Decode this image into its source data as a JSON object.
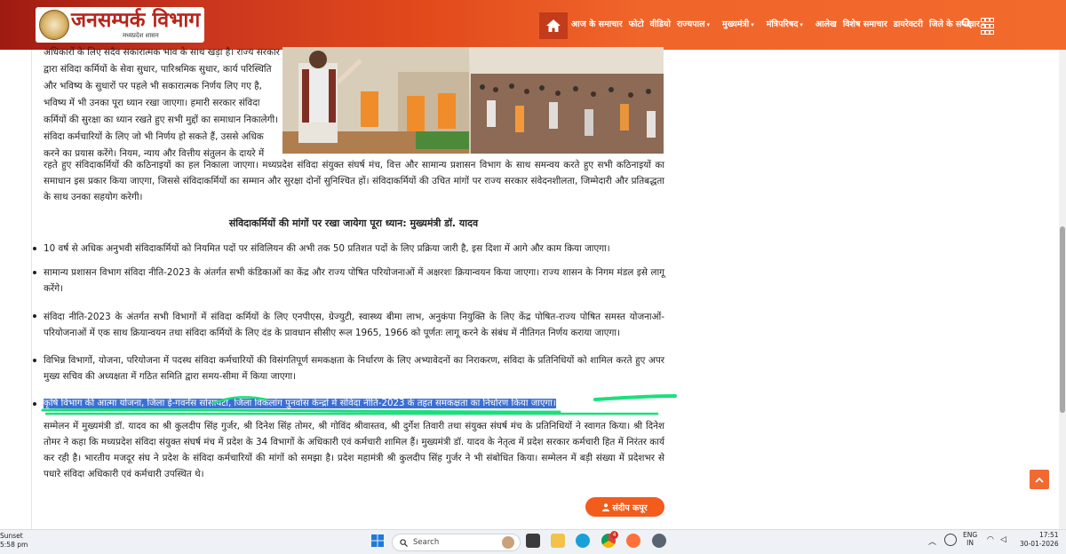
{
  "header": {
    "logo_title": "जनसम्पर्क विभाग",
    "logo_subtitle": "मध्यप्रदेश शासन",
    "nav_items": [
      {
        "label": "आज के समाचार",
        "caret": false
      },
      {
        "label": "फोटो",
        "caret": false
      },
      {
        "label": "वीडियो",
        "caret": false
      },
      {
        "label": "राज्यपाल",
        "caret": true
      },
      {
        "label": "मुख्यमंत्री",
        "caret": true
      },
      {
        "label": "मंत्रिपरिषद",
        "caret": true
      },
      {
        "label": "आलेख",
        "caret": false
      },
      {
        "label": "विशेष समाचार",
        "caret": false
      },
      {
        "label": "डायरेक्टरी",
        "caret": false
      },
      {
        "label": "जिले के समाचार",
        "caret": true
      }
    ],
    "caret_glyph": "▾",
    "brand_color": "#f36a2d"
  },
  "article": {
    "intro_lines": [
      "अधिकारों के लिए सदैव सकारात्मक भाव के साथ खड़ा है। राज्य सरकार",
      "द्वारा संविदा कर्मियों के सेवा सुधार, पारिश्रमिक सुधार, कार्य परिस्थिति",
      "और भविष्य के सुधारों पर पहले भी सकारात्मक निर्णय लिए गए है,",
      "भविष्य में भी उनका पूरा ध्यान रखा जाएगा। हमारी सरकार संविदा",
      "कर्मियों की सुरक्षा का ध्यान रखते हुए सभी मुद्दों का समाधान निकालेगी।",
      "संविदा कर्मचारियों के लिए जो भी निर्णय हो सकते हैं, उससे अधिक",
      "करने का प्रयास करेंगे। नियम, न्याय और वित्तीय संतुलन के दायरे में"
    ],
    "intro_full": "रहते हुए संविदाकर्मियों की कठिनाइयों का हल निकाला जाएगा। मध्यप्रदेश संविदा संयुक्त संघर्ष मंच, वित्त और सामान्य प्रशासन विभाग के साथ समन्वय करते हुए सभी कठिनाइयों का समाधान इस प्रकार किया जाएगा, जिससे संविदाकर्मियों का सम्मान और सुरक्षा दोनों सुनिश्चित हों। संविदाकर्मियों की उचित मांगों पर राज्य सरकार संवेदनशीलता, जिम्मेदारी और प्रतिबद्धता के साथ उनका सहयोग करेगी।",
    "subheading": "संविदाकर्मियों की मांगों पर रखा जायेगा पूरा ध्यान: मुख्यमंत्री डॉ. यादव",
    "bullets": [
      "10 वर्ष से अधिक अनुभवी संविदाकर्मियों को नियमित पदों पर संविलियन की अभी तक 50 प्रतिशत पदों के लिए प्रक्रिया जारी है, इस दिशा में आगे और काम किया जाएगा।",
      "सामान्य प्रशासन विभाग संविदा नीति-2023 के अंतर्गत सभी कंडिकाओं का केंद्र और राज्य पोषित परियोजनाओं में अक्षरशः क्रियान्वयन किया जाएगा। राज्य शासन के निगम मंडल इसे लागू करेंगे।",
      "संविदा नीति-2023 के अंतर्गत सभी विभागों में संविदा कर्मियों के लिए एनपीएस, ग्रेज्युटी, स्वास्थ्य बीमा लाभ, अनुकंपा नियुक्ति के लिए केंद्र पोषित-राज्य पोषित समस्त योजनाओं-परियोजनाओं में एक साथ क्रियान्वयन तथा संविदा कर्मियों के लिए दंड के प्रावधान सीसीए रूल 1965, 1966 को पूर्णतः लागू करने के संबंध में नीतिगत निर्णय कराया जाएगा।",
      "विभिन्न विभागों, योजना, परियोजना में पदस्थ संविदा कर्मचारियों की विसंगतिपूर्ण समकक्षता के निर्धारण के लिए अभ्यावेदनों का निराकरण, संविदा के प्रतिनिधियों को शामिल करते हुए अपर मुख्य सचिव की अध्यक्षता में गठित समिति द्वारा समय-सीमा में किया जाएगा।",
      "कृषि विभाग की आत्मा योजना, जिला ई-गवर्नेंस सोसायटी, जिला विकलांग पुनर्वास केन्द्रों में संविदा नीति-2023 के तहत समकक्षता का निर्धारण किया जाएगा।"
    ],
    "closing": "सम्मेलन में मुख्यमंत्री डॉ. यादव का श्री कुलदीप सिंह गुर्जर, श्री दिनेश सिंह तोमर, श्री गोविंद श्रीवास्तव, श्री दुर्गेश तिवारी तथा संयुक्त संघर्ष मंच के प्रतिनिधियों ने स्वागत किया। श्री दिनेश तोमर ने कहा कि मध्यप्रदेश संविदा संयुक्त संघर्ष मंच में प्रदेश के 34 विभागों के अधिकारी एवं कर्मचारी शामिल हैं। मुख्यमंत्री डॉ. यादव के नेतृत्व में प्रदेश सरकार कर्मचारी हित में निरंतर कार्य कर रही है। भारतीय मजदूर संघ ने प्रदेश के संविदा कर्मचारियों की मांगों को समझा है। प्रदेश महामंत्री श्री कुलदीप सिंह गुर्जर ने भी संबोधित किया। सम्मेलन में बड़ी संख्या में प्रदेशभर से पधारे संविदा अधिकारी एवं कर्मचारी उपस्थित थे।",
    "author": "संदीप कपूर"
  },
  "taskbar": {
    "weather_label": "Sunset",
    "time_left": "5:58 pm",
    "search_placeholder": "Search",
    "lang_top": "ENG",
    "lang_bottom": "IN",
    "clock_time": "17:51",
    "clock_date": "30-01-2026",
    "notification_count": "4"
  }
}
